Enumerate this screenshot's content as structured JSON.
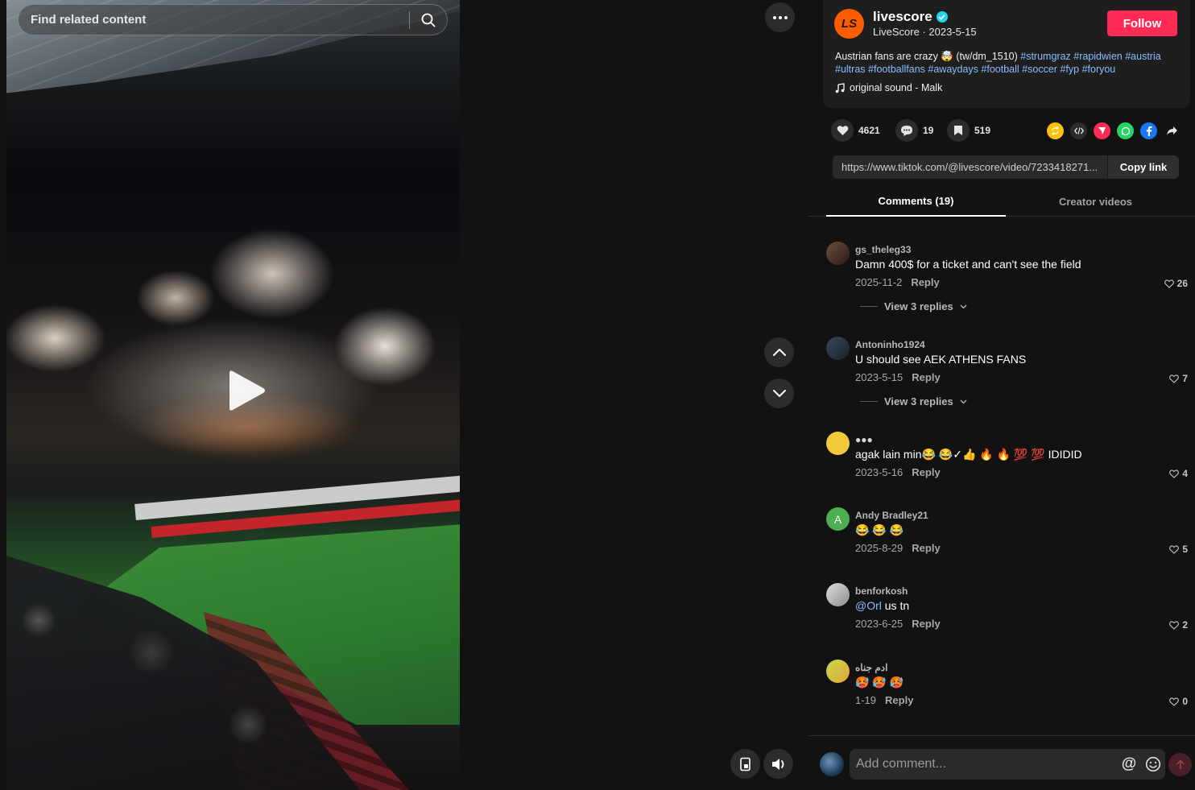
{
  "search": {
    "placeholder": "Find related content"
  },
  "video": {
    "state": "paused"
  },
  "author": {
    "initials": "LS",
    "name": "livescore",
    "display": "LiveScore",
    "date": "2023-5-15",
    "follow_label": "Follow"
  },
  "description": {
    "text": "Austrian fans are crazy 🤯 (tw/dm_1510) ",
    "hashtags": [
      "#strumgraz",
      "#rapidwien",
      "#austria",
      "#ultras",
      "#footballfans",
      "#awaydays",
      "#football",
      "#soccer",
      "#fyp",
      "#foryou"
    ]
  },
  "sound": "original sound - Malk",
  "stats": {
    "likes": "4621",
    "comments": "19",
    "saves": "519"
  },
  "link": {
    "url": "https://www.tiktok.com/@livescore/video/7233418271...",
    "copy_label": "Copy link"
  },
  "tabs": {
    "comments": "Comments (19)",
    "creator": "Creator videos"
  },
  "comments": [
    {
      "user": "gs_theleg33",
      "text": "Damn 400$ for a ticket and can't see the field",
      "date": "2025-11-2",
      "reply": "Reply",
      "likes": "26",
      "replies": "View 3 replies",
      "avatar": ""
    },
    {
      "user": "Antoninho1924",
      "text": "U should see AEK ATHENS FANS",
      "date": "2023-5-15",
      "reply": "Reply",
      "likes": "7",
      "replies": "View 3 replies",
      "avatar": ""
    },
    {
      "user": "●●●",
      "text": "agak lain min😂 😂✓👍 🔥 🔥 💯 💯 IDIDID",
      "date": "2023-5-16",
      "reply": "Reply",
      "likes": "4",
      "avatar": ""
    },
    {
      "user": "Andy Bradley21",
      "text": "😂 😂 😂",
      "date": "2025-8-29",
      "reply": "Reply",
      "likes": "5",
      "avatar": "A"
    },
    {
      "user": "benforkosh",
      "mention": "@Orl",
      "text": " us tn",
      "date": "2023-6-25",
      "reply": "Reply",
      "likes": "2",
      "avatar": ""
    },
    {
      "user": "ادم جناه",
      "text": "🥵 🥵 🥵",
      "date": "1-19",
      "reply": "Reply",
      "likes": "0",
      "avatar": ""
    }
  ],
  "comment_box": {
    "placeholder": "Add comment...",
    "mention_icon": "@"
  },
  "colors": {
    "accent": "#fe2c55",
    "brand": "#ff5c00",
    "link": "#8bbcff"
  }
}
